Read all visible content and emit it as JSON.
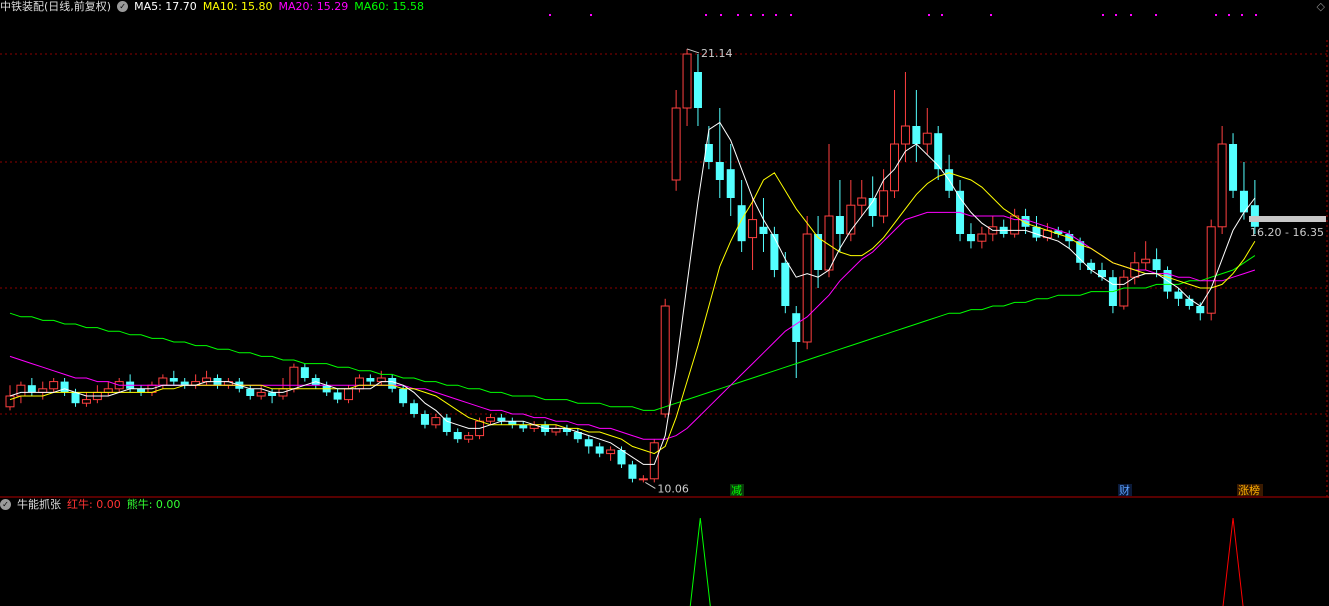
{
  "header": {
    "stock_title": "中铁装配(日线,前复权)",
    "indicators": [
      {
        "label": "MA5: 17.70",
        "color": "#ffffff"
      },
      {
        "label": "MA10: 15.80",
        "color": "#ffff00"
      },
      {
        "label": "MA20: 15.29",
        "color": "#ff00ff"
      },
      {
        "label": "MA60: 15.58",
        "color": "#00ff00"
      }
    ]
  },
  "price_labels": {
    "high": "21.14",
    "low": "10.06",
    "range": "16.20 - 16.35"
  },
  "markers": {
    "jian": "减",
    "cai": "财",
    "zhangbang": "涨榜"
  },
  "sub_panel": {
    "title": "牛能抓张",
    "red_label": "红牛: 0.00",
    "green_label": "熊牛: 0.00"
  },
  "colors": {
    "up": "#ff4040",
    "down": "#54ffff",
    "ma5": "#ffffff",
    "ma10": "#ffff00",
    "ma20": "#ff00ff",
    "ma60": "#00ff00",
    "grid": "#8b0000"
  },
  "chart_data": {
    "type": "candlestick",
    "price_range": [
      9.0,
      22.0
    ],
    "candles": [
      [
        11.2,
        11.5,
        11.1,
        11.8
      ],
      [
        11.5,
        11.8,
        11.3,
        11.9
      ],
      [
        11.8,
        11.6,
        11.5,
        12.0
      ],
      [
        11.6,
        11.7,
        11.4,
        11.9
      ],
      [
        11.7,
        11.9,
        11.6,
        12.0
      ],
      [
        11.9,
        11.6,
        11.5,
        12.0
      ],
      [
        11.6,
        11.3,
        11.2,
        11.7
      ],
      [
        11.3,
        11.4,
        11.2,
        11.6
      ],
      [
        11.4,
        11.6,
        11.3,
        11.8
      ],
      [
        11.6,
        11.7,
        11.5,
        11.9
      ],
      [
        11.7,
        11.9,
        11.6,
        12.0
      ],
      [
        11.9,
        11.7,
        11.6,
        12.1
      ],
      [
        11.7,
        11.6,
        11.5,
        11.8
      ],
      [
        11.6,
        11.8,
        11.5,
        11.9
      ],
      [
        11.8,
        12.0,
        11.7,
        12.1
      ],
      [
        12.0,
        11.9,
        11.8,
        12.2
      ],
      [
        11.9,
        11.8,
        11.7,
        12.0
      ],
      [
        11.8,
        11.9,
        11.7,
        12.1
      ],
      [
        11.9,
        12.0,
        11.8,
        12.2
      ],
      [
        12.0,
        11.8,
        11.7,
        12.1
      ],
      [
        11.8,
        11.9,
        11.7,
        12.0
      ],
      [
        11.9,
        11.7,
        11.6,
        12.0
      ],
      [
        11.7,
        11.5,
        11.4,
        11.8
      ],
      [
        11.5,
        11.6,
        11.4,
        11.8
      ],
      [
        11.6,
        11.5,
        11.3,
        11.7
      ],
      [
        11.5,
        11.7,
        11.4,
        12.0
      ],
      [
        11.7,
        12.3,
        11.6,
        12.4
      ],
      [
        12.3,
        12.0,
        11.9,
        12.4
      ],
      [
        12.0,
        11.8,
        11.7,
        12.1
      ],
      [
        11.8,
        11.6,
        11.5,
        11.9
      ],
      [
        11.6,
        11.4,
        11.3,
        11.7
      ],
      [
        11.4,
        11.7,
        11.3,
        11.8
      ],
      [
        11.7,
        12.0,
        11.6,
        12.1
      ],
      [
        12.0,
        11.9,
        11.8,
        12.1
      ],
      [
        11.9,
        12.0,
        11.8,
        12.2
      ],
      [
        12.0,
        11.7,
        11.6,
        12.1
      ],
      [
        11.7,
        11.3,
        11.2,
        11.8
      ],
      [
        11.3,
        11.0,
        10.9,
        11.4
      ],
      [
        11.0,
        10.7,
        10.6,
        11.1
      ],
      [
        10.7,
        10.9,
        10.6,
        11.0
      ],
      [
        10.9,
        10.5,
        10.4,
        11.0
      ],
      [
        10.5,
        10.3,
        10.2,
        10.6
      ],
      [
        10.3,
        10.4,
        10.2,
        10.5
      ],
      [
        10.4,
        10.8,
        10.3,
        10.9
      ],
      [
        10.8,
        10.9,
        10.7,
        11.0
      ],
      [
        10.9,
        10.8,
        10.7,
        11.0
      ],
      [
        10.8,
        10.7,
        10.6,
        10.9
      ],
      [
        10.7,
        10.6,
        10.5,
        10.8
      ],
      [
        10.6,
        10.7,
        10.5,
        10.8
      ],
      [
        10.7,
        10.5,
        10.4,
        10.8
      ],
      [
        10.5,
        10.6,
        10.4,
        10.7
      ],
      [
        10.6,
        10.5,
        10.4,
        10.7
      ],
      [
        10.5,
        10.3,
        10.2,
        10.6
      ],
      [
        10.3,
        10.1,
        9.9,
        10.4
      ],
      [
        10.1,
        9.9,
        9.8,
        10.2
      ],
      [
        9.9,
        10.0,
        9.7,
        10.1
      ],
      [
        10.0,
        9.6,
        9.5,
        10.1
      ],
      [
        9.6,
        9.2,
        9.1,
        9.7
      ],
      [
        9.2,
        9.2,
        9.1,
        9.3
      ],
      [
        9.2,
        10.2,
        9.1,
        10.3
      ],
      [
        11.0,
        14.0,
        10.9,
        14.2
      ],
      [
        17.5,
        19.5,
        17.2,
        20.0
      ],
      [
        19.5,
        21.0,
        19.0,
        21.14
      ],
      [
        20.5,
        19.5,
        19.0,
        21.0
      ],
      [
        18.5,
        18.0,
        17.8,
        19.0
      ],
      [
        18.0,
        17.5,
        17.0,
        19.5
      ],
      [
        17.8,
        17.0,
        16.5,
        18.5
      ],
      [
        16.8,
        15.8,
        15.5,
        17.5
      ],
      [
        15.9,
        16.4,
        15.0,
        17.0
      ],
      [
        16.2,
        16.0,
        15.5,
        17.0
      ],
      [
        16.0,
        15.0,
        14.8,
        16.2
      ],
      [
        15.2,
        14.0,
        13.8,
        15.5
      ],
      [
        13.8,
        13.0,
        12.0,
        14.0
      ],
      [
        13.0,
        16.0,
        12.8,
        16.5
      ],
      [
        16.0,
        15.0,
        14.5,
        16.5
      ],
      [
        15.0,
        16.5,
        14.8,
        18.5
      ],
      [
        16.5,
        16.0,
        15.5,
        17.5
      ],
      [
        16.0,
        16.8,
        15.8,
        17.5
      ],
      [
        16.8,
        17.0,
        16.5,
        17.5
      ],
      [
        17.0,
        16.5,
        16.2,
        17.6
      ],
      [
        16.5,
        17.2,
        16.3,
        17.8
      ],
      [
        17.2,
        18.5,
        17.0,
        20.0
      ],
      [
        18.5,
        19.0,
        18.0,
        20.5
      ],
      [
        19.0,
        18.5,
        18.0,
        20.0
      ],
      [
        18.5,
        18.8,
        18.2,
        19.5
      ],
      [
        18.8,
        17.8,
        17.5,
        19.0
      ],
      [
        17.8,
        17.2,
        17.0,
        18.2
      ],
      [
        17.2,
        16.0,
        15.8,
        17.5
      ],
      [
        16.0,
        15.8,
        15.6,
        16.3
      ],
      [
        15.8,
        16.0,
        15.6,
        16.2
      ],
      [
        16.0,
        16.2,
        15.8,
        16.5
      ],
      [
        16.2,
        16.0,
        15.9,
        16.4
      ],
      [
        16.0,
        16.5,
        15.9,
        16.7
      ],
      [
        16.5,
        16.2,
        16.0,
        16.7
      ],
      [
        16.2,
        15.9,
        15.8,
        16.5
      ],
      [
        15.9,
        16.1,
        15.8,
        16.3
      ],
      [
        16.1,
        16.0,
        15.9,
        16.2
      ],
      [
        16.0,
        15.8,
        15.6,
        16.1
      ],
      [
        15.8,
        15.2,
        15.0,
        15.9
      ],
      [
        15.2,
        15.0,
        14.9,
        15.3
      ],
      [
        15.0,
        14.8,
        14.7,
        15.2
      ],
      [
        14.8,
        14.0,
        13.8,
        15.0
      ],
      [
        14.0,
        14.8,
        13.9,
        15.0
      ],
      [
        14.8,
        15.2,
        14.6,
        15.5
      ],
      [
        15.2,
        15.3,
        15.0,
        15.8
      ],
      [
        15.3,
        15.0,
        14.8,
        15.6
      ],
      [
        15.0,
        14.4,
        14.2,
        15.1
      ],
      [
        14.4,
        14.2,
        14.0,
        14.5
      ],
      [
        14.2,
        14.0,
        13.9,
        14.3
      ],
      [
        14.0,
        13.8,
        13.6,
        14.1
      ],
      [
        13.8,
        16.2,
        13.6,
        16.4
      ],
      [
        16.2,
        18.5,
        16.0,
        19.0
      ],
      [
        18.5,
        17.2,
        17.0,
        18.8
      ],
      [
        17.2,
        16.6,
        16.4,
        18.0
      ],
      [
        16.8,
        16.2,
        16.0,
        17.5
      ]
    ],
    "ma5": [
      11.5,
      11.6,
      11.6,
      11.6,
      11.6,
      11.7,
      11.6,
      11.5,
      11.5,
      11.5,
      11.6,
      11.7,
      11.7,
      11.7,
      11.8,
      11.8,
      11.8,
      11.8,
      11.9,
      11.9,
      11.9,
      11.8,
      11.7,
      11.7,
      11.6,
      11.6,
      11.7,
      11.8,
      11.9,
      11.8,
      11.7,
      11.7,
      11.7,
      11.7,
      11.9,
      11.9,
      11.8,
      11.6,
      11.3,
      11.1,
      10.8,
      10.7,
      10.6,
      10.6,
      10.7,
      10.8,
      10.8,
      10.8,
      10.7,
      10.6,
      10.6,
      10.6,
      10.5,
      10.4,
      10.3,
      10.2,
      10.0,
      9.8,
      9.6,
      9.6,
      10.4,
      12.3,
      14.6,
      16.9,
      18.9,
      19.1,
      18.6,
      17.8,
      17.0,
      16.4,
      15.9,
      15.3,
      14.8,
      14.9,
      14.8,
      15.0,
      15.6,
      16.1,
      16.5,
      16.9,
      17.5,
      17.8,
      18.3,
      18.5,
      18.2,
      17.9,
      17.5,
      17.0,
      16.6,
      16.3,
      16.1,
      16.1,
      16.1,
      16.1,
      16.0,
      15.9,
      15.8,
      15.6,
      15.3,
      15.0,
      14.8,
      14.6,
      14.6,
      14.8,
      14.9,
      14.9,
      14.7,
      14.5,
      14.2,
      14.0,
      14.5,
      15.3,
      16.1,
      16.6,
      17.0
    ],
    "ma10": [
      11.4,
      11.5,
      11.5,
      11.5,
      11.6,
      11.6,
      11.6,
      11.6,
      11.6,
      11.6,
      11.6,
      11.6,
      11.6,
      11.6,
      11.7,
      11.7,
      11.8,
      11.8,
      11.8,
      11.8,
      11.8,
      11.8,
      11.8,
      11.8,
      11.7,
      11.7,
      11.7,
      11.7,
      11.7,
      11.7,
      11.7,
      11.7,
      11.8,
      11.8,
      11.8,
      11.8,
      11.7,
      11.7,
      11.6,
      11.5,
      11.3,
      11.1,
      10.9,
      10.8,
      10.7,
      10.7,
      10.7,
      10.7,
      10.7,
      10.7,
      10.7,
      10.6,
      10.6,
      10.5,
      10.5,
      10.4,
      10.3,
      10.1,
      10.0,
      9.9,
      10.1,
      10.9,
      11.9,
      12.9,
      14.0,
      15.1,
      15.8,
      16.4,
      16.9,
      17.5,
      17.7,
      17.2,
      16.7,
      16.3,
      15.9,
      15.7,
      15.5,
      15.4,
      15.4,
      15.6,
      15.9,
      16.3,
      16.7,
      17.1,
      17.4,
      17.6,
      17.7,
      17.6,
      17.5,
      17.3,
      17.0,
      16.7,
      16.5,
      16.3,
      16.2,
      16.1,
      16.0,
      15.9,
      15.7,
      15.6,
      15.4,
      15.2,
      15.1,
      15.0,
      14.9,
      14.9,
      14.8,
      14.7,
      14.6,
      14.5,
      14.5,
      14.6,
      14.9,
      15.3,
      15.8
    ],
    "ma20": [
      12.6,
      12.5,
      12.4,
      12.3,
      12.2,
      12.1,
      12.0,
      12.0,
      11.9,
      11.9,
      11.8,
      11.8,
      11.8,
      11.8,
      11.8,
      11.8,
      11.8,
      11.8,
      11.8,
      11.8,
      11.8,
      11.8,
      11.8,
      11.8,
      11.8,
      11.8,
      11.8,
      11.8,
      11.8,
      11.8,
      11.8,
      11.8,
      11.8,
      11.8,
      11.8,
      11.8,
      11.8,
      11.7,
      11.7,
      11.6,
      11.5,
      11.4,
      11.3,
      11.2,
      11.1,
      11.1,
      11.0,
      11.0,
      10.9,
      10.9,
      10.8,
      10.8,
      10.7,
      10.7,
      10.6,
      10.6,
      10.5,
      10.4,
      10.3,
      10.3,
      10.3,
      10.4,
      10.6,
      10.9,
      11.2,
      11.5,
      11.8,
      12.1,
      12.4,
      12.7,
      13.0,
      13.3,
      13.5,
      13.7,
      14.0,
      14.3,
      14.7,
      15.0,
      15.3,
      15.5,
      15.8,
      16.1,
      16.4,
      16.5,
      16.6,
      16.6,
      16.6,
      16.6,
      16.5,
      16.5,
      16.5,
      16.5,
      16.4,
      16.4,
      16.3,
      16.2,
      16.1,
      16.0,
      15.8,
      15.6,
      15.4,
      15.2,
      15.1,
      15.0,
      15.0,
      14.9,
      14.9,
      14.8,
      14.8,
      14.7,
      14.7,
      14.7,
      14.8,
      14.9,
      15.0
    ],
    "ma60": [
      13.8,
      13.7,
      13.7,
      13.6,
      13.6,
      13.5,
      13.5,
      13.4,
      13.4,
      13.3,
      13.3,
      13.2,
      13.2,
      13.1,
      13.1,
      13.0,
      13.0,
      12.9,
      12.9,
      12.8,
      12.8,
      12.7,
      12.7,
      12.6,
      12.6,
      12.5,
      12.5,
      12.4,
      12.4,
      12.4,
      12.3,
      12.3,
      12.2,
      12.2,
      12.1,
      12.1,
      12.0,
      12.0,
      11.9,
      11.9,
      11.8,
      11.8,
      11.7,
      11.7,
      11.6,
      11.6,
      11.5,
      11.5,
      11.5,
      11.4,
      11.4,
      11.4,
      11.3,
      11.3,
      11.3,
      11.2,
      11.2,
      11.2,
      11.1,
      11.1,
      11.2,
      11.3,
      11.4,
      11.5,
      11.6,
      11.7,
      11.8,
      11.9,
      12.0,
      12.1,
      12.2,
      12.3,
      12.4,
      12.5,
      12.6,
      12.7,
      12.8,
      12.9,
      13.0,
      13.1,
      13.2,
      13.3,
      13.4,
      13.5,
      13.6,
      13.7,
      13.8,
      13.8,
      13.9,
      13.9,
      14.0,
      14.0,
      14.1,
      14.1,
      14.2,
      14.2,
      14.3,
      14.3,
      14.3,
      14.4,
      14.4,
      14.4,
      14.5,
      14.5,
      14.5,
      14.6,
      14.6,
      14.6,
      14.7,
      14.7,
      14.8,
      14.9,
      15.0,
      15.2,
      15.4
    ],
    "dotted_levels": [
      21.0,
      18.0,
      14.5,
      11.0
    ],
    "signals": [
      {
        "index": 59,
        "color": "#00ff00"
      },
      {
        "index": 112,
        "color": "#ff0000"
      }
    ]
  }
}
